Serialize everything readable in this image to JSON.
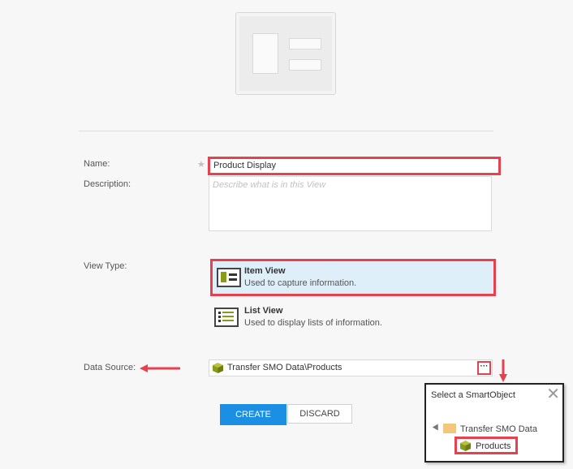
{
  "form": {
    "name_label": "Name:",
    "name_value": "Product Display",
    "description_label": "Description:",
    "description_placeholder": "Describe what is in this View",
    "view_type_label": "View Type:",
    "view_types": [
      {
        "title": "Item View",
        "subtitle": "Used to capture information.",
        "selected": true
      },
      {
        "title": "List View",
        "subtitle": "Used to display lists of information.",
        "selected": false
      }
    ],
    "data_source_label": "Data Source:",
    "data_source_value": "Transfer SMO Data\\Products",
    "browse_label": "···"
  },
  "buttons": {
    "create": "CREATE",
    "discard": "DISCARD"
  },
  "popup": {
    "title": "Select a SmartObject",
    "close": "✕",
    "tree": [
      {
        "label": "Transfer SMO Data",
        "children": [
          {
            "label": "Products",
            "selected": true
          }
        ]
      }
    ]
  },
  "colors": {
    "accent": "#1a8fe3",
    "highlight": "#e8414e",
    "selected_bg": "#dfeffa",
    "smartobject_icon": "#8a9a1b"
  }
}
